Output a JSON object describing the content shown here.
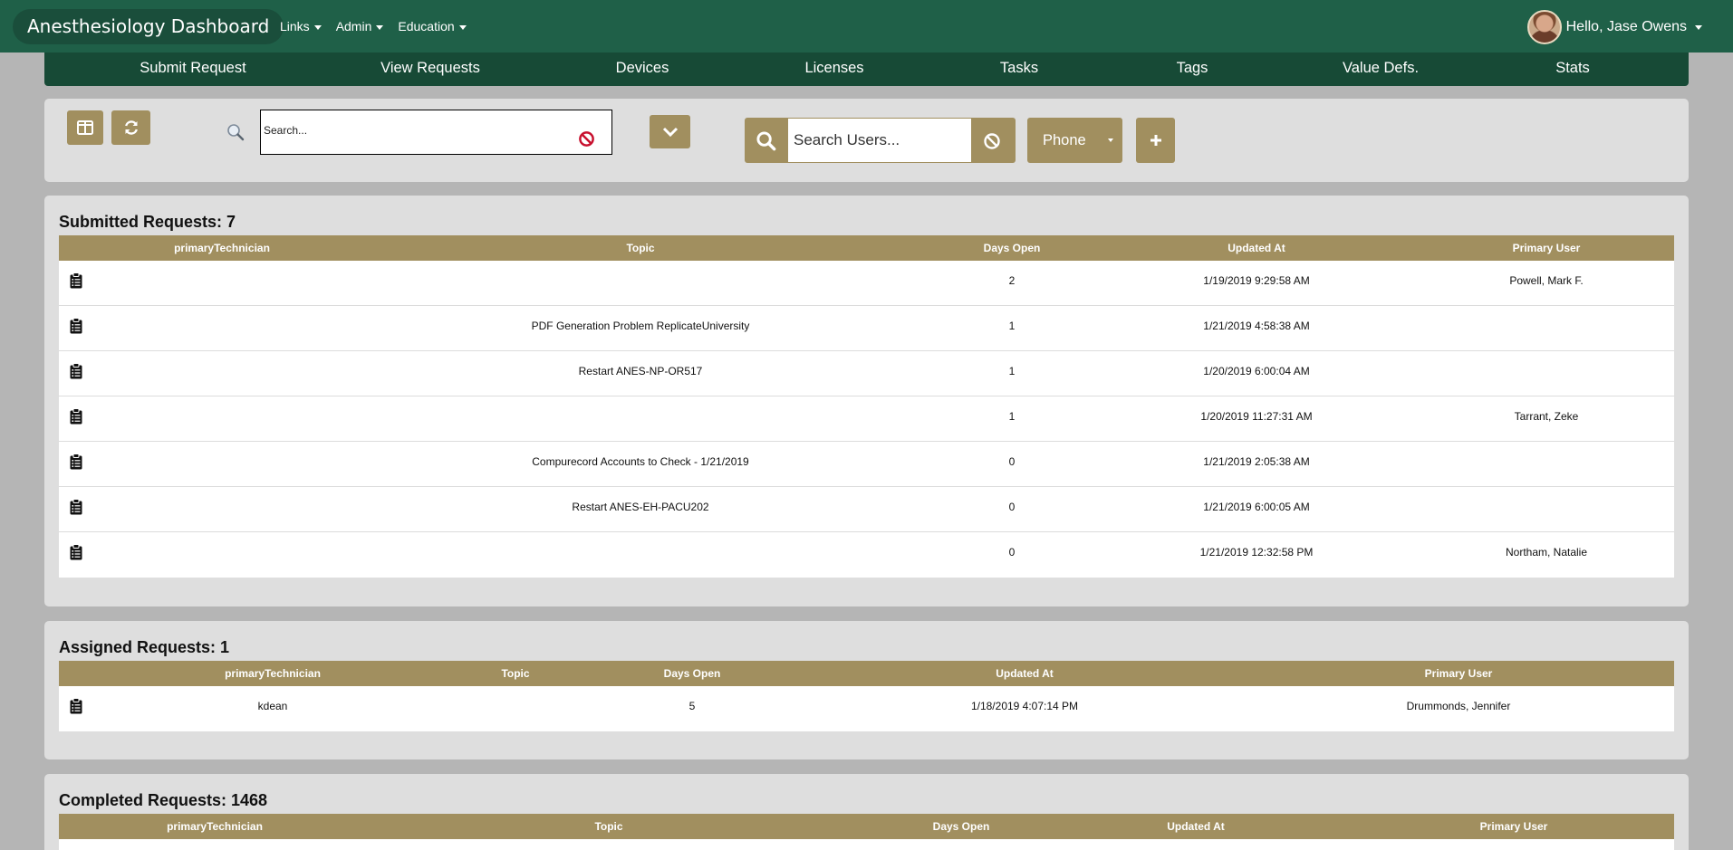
{
  "topbar": {
    "brand": "Anesthesiology Dashboard",
    "menus": [
      "Links",
      "Admin",
      "Education"
    ],
    "user_greeting": "Hello, Jase Owens"
  },
  "subnav": [
    "Submit Request",
    "View Requests",
    "Devices",
    "Licenses",
    "Tasks",
    "Tags",
    "Value Defs.",
    "Stats"
  ],
  "toolbar": {
    "search_placeholder": "Search...",
    "user_search_placeholder": "Search Users...",
    "phone_label": "Phone",
    "icons": [
      "columns-icon",
      "refresh-icon",
      "magnifier-icon",
      "clear-icon",
      "chevron-down-icon",
      "search-icon",
      "ban-icon",
      "caret-down-icon",
      "plus-icon"
    ]
  },
  "submitted": {
    "title": "Submitted Requests: 7",
    "columns": [
      "primaryTechnician",
      "Topic",
      "Days Open",
      "Updated At",
      "Primary User"
    ],
    "rows": [
      [
        "",
        "",
        "2",
        "1/19/2019 9:29:58 AM",
        "Powell, Mark F."
      ],
      [
        "",
        "PDF Generation Problem ReplicateUniversity",
        "1",
        "1/21/2019 4:58:38 AM",
        ""
      ],
      [
        "",
        "Restart ANES-NP-OR517",
        "1",
        "1/20/2019 6:00:04 AM",
        ""
      ],
      [
        "",
        "",
        "1",
        "1/20/2019 11:27:31 AM",
        "Tarrant, Zeke"
      ],
      [
        "",
        "Compurecord Accounts to Check - 1/21/2019",
        "0",
        "1/21/2019 2:05:38 AM",
        ""
      ],
      [
        "",
        "Restart ANES-EH-PACU202",
        "0",
        "1/21/2019 6:00:05 AM",
        ""
      ],
      [
        "",
        "",
        "0",
        "1/21/2019 12:32:58 PM",
        "Northam, Natalie"
      ]
    ]
  },
  "assigned": {
    "title": "Assigned Requests: 1",
    "columns": [
      "primaryTechnician",
      "Topic",
      "Days Open",
      "Updated At",
      "Primary User"
    ],
    "rows": [
      [
        "kdean",
        "",
        "5",
        "1/18/2019 4:07:14 PM",
        "Drummonds, Jennifer"
      ]
    ]
  },
  "completed": {
    "title": "Completed Requests: 1468",
    "columns": [
      "primaryTechnician",
      "Topic",
      "Days Open",
      "Updated At",
      "Primary User"
    ]
  },
  "colors": {
    "green": "#1f6048",
    "dark_green": "#174a36",
    "gold": "#a18f5f",
    "panel": "#dedede"
  }
}
